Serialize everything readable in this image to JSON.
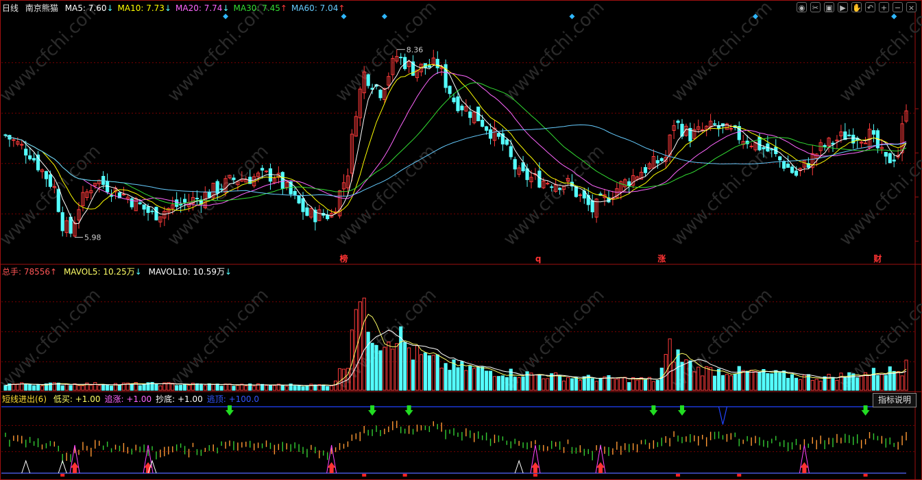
{
  "header": {
    "period": "日线",
    "stock_name": "南京熊猫",
    "ma": [
      {
        "label": "MA5: 7.60",
        "arrow": "↓",
        "color": "#ffffff"
      },
      {
        "label": "MA10: 7.73",
        "arrow": "↓",
        "color": "#ffff00"
      },
      {
        "label": "MA20: 7.74",
        "arrow": "↓",
        "color": "#ff66ff"
      },
      {
        "label": "MA30: 7.45",
        "arrow": "↑",
        "color": "#33dd33"
      },
      {
        "label": "MA60: 7.04",
        "arrow": "↑",
        "color": "#66ccff"
      }
    ]
  },
  "toolbar_icons": [
    "eye-icon",
    "scissors-icon",
    "save-icon",
    "play-icon",
    "hand-icon",
    "undo-icon",
    "zoom-in-icon",
    "zoom-out-icon",
    "close-icon"
  ],
  "price_panel": {
    "high_label": "8.36",
    "low_label": "5.98",
    "event_markers": [
      {
        "text": "榜",
        "x_index": 83
      },
      {
        "text": "q",
        "x_index": 131
      },
      {
        "text": "涨",
        "x_index": 161
      },
      {
        "text": "财",
        "x_index": 214
      }
    ]
  },
  "volume_panel": {
    "total": "总手: 78556",
    "total_arrow": "↑",
    "mavol5": "MAVOL5: 10.25万",
    "mavol5_arrow": "↓",
    "mavol10": "MAVOL10: 10.59万",
    "mavol10_arrow": "↓"
  },
  "indicator_panel": {
    "name": "短线进出(6)",
    "items": [
      {
        "label": "低买: +1.00",
        "color": "#ffff66"
      },
      {
        "label": "追涨: +1.00",
        "color": "#ff66ff"
      },
      {
        "label": "抄底: +1.00",
        "color": "#ffffff"
      },
      {
        "label": "逃顶: +100.0",
        "color": "#3355ff"
      }
    ],
    "explain_button": "指标说明"
  },
  "colors": {
    "up": "#ff3b3b",
    "down": "#54ffff",
    "grid": "#7a0000",
    "border": "#a01010",
    "watermark": "#2a2a2a"
  },
  "chart_data": {
    "type": "candlestick",
    "title": "南京熊猫 日线",
    "ylim": [
      5.8,
      8.5
    ],
    "high": 8.36,
    "low": 5.98,
    "n": 222,
    "ma_periods": [
      5,
      10,
      20,
      30,
      60
    ],
    "close_keypoints": [
      [
        0,
        7.2
      ],
      [
        6,
        7.0
      ],
      [
        12,
        6.6
      ],
      [
        14,
        6.2
      ],
      [
        16,
        6.1
      ],
      [
        18,
        6.4
      ],
      [
        22,
        6.7
      ],
      [
        30,
        6.5
      ],
      [
        36,
        6.3
      ],
      [
        42,
        6.4
      ],
      [
        48,
        6.5
      ],
      [
        56,
        6.7
      ],
      [
        66,
        6.75
      ],
      [
        74,
        6.3
      ],
      [
        80,
        6.3
      ],
      [
        84,
        6.8
      ],
      [
        86,
        7.5
      ],
      [
        88,
        7.9
      ],
      [
        92,
        7.7
      ],
      [
        96,
        8.1
      ],
      [
        100,
        7.95
      ],
      [
        106,
        8.0
      ],
      [
        110,
        7.6
      ],
      [
        116,
        7.4
      ],
      [
        122,
        7.1
      ],
      [
        126,
        6.75
      ],
      [
        130,
        6.7
      ],
      [
        138,
        6.65
      ],
      [
        144,
        6.35
      ],
      [
        150,
        6.6
      ],
      [
        156,
        6.8
      ],
      [
        162,
        6.95
      ],
      [
        164,
        7.35
      ],
      [
        168,
        7.2
      ],
      [
        174,
        7.3
      ],
      [
        182,
        7.15
      ],
      [
        188,
        7.0
      ],
      [
        194,
        6.75
      ],
      [
        200,
        7.05
      ],
      [
        206,
        7.2
      ],
      [
        212,
        7.2
      ],
      [
        216,
        6.9
      ],
      [
        219,
        7.0
      ],
      [
        221,
        7.55
      ]
    ],
    "volume_keypoints": [
      [
        0,
        3
      ],
      [
        40,
        3
      ],
      [
        60,
        2.5
      ],
      [
        80,
        2.5
      ],
      [
        84,
        15
      ],
      [
        86,
        50
      ],
      [
        88,
        35
      ],
      [
        92,
        25
      ],
      [
        96,
        28
      ],
      [
        100,
        18
      ],
      [
        108,
        12
      ],
      [
        120,
        9
      ],
      [
        140,
        6
      ],
      [
        160,
        5
      ],
      [
        163,
        20
      ],
      [
        166,
        15
      ],
      [
        170,
        10
      ],
      [
        180,
        9
      ],
      [
        200,
        6
      ],
      [
        220,
        10
      ],
      [
        221,
        18
      ]
    ],
    "volume_ylim": [
      0,
      55
    ],
    "buy_signals": [
      17,
      35,
      80,
      130,
      146,
      196
    ],
    "sell_signals": [
      55,
      90,
      99,
      159,
      166,
      211
    ]
  }
}
